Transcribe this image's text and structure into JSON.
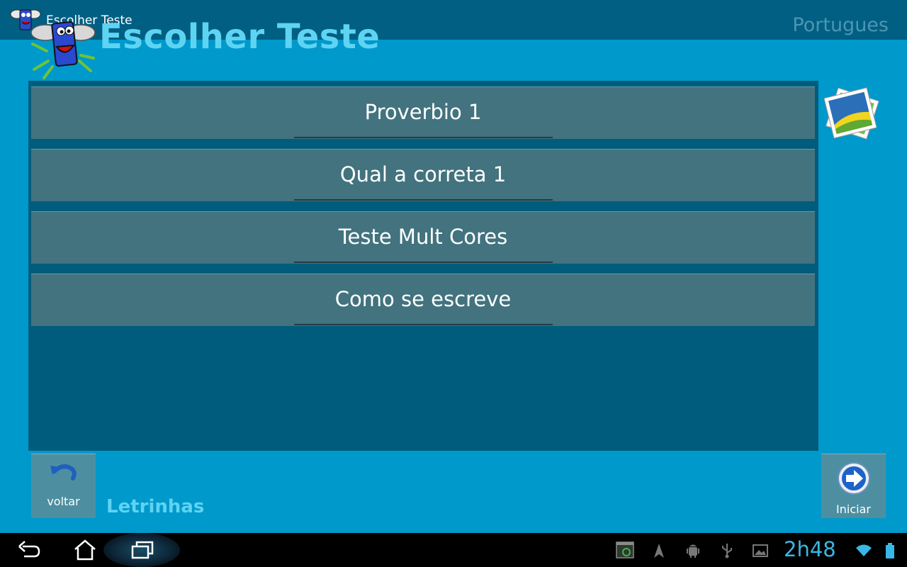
{
  "action_bar": {
    "title": "Escolher Teste",
    "language": "Portugues"
  },
  "header": {
    "title": "Escolher Teste"
  },
  "tests": [
    {
      "label": "Proverbio 1"
    },
    {
      "label": "Qual a correta 1"
    },
    {
      "label": "Teste Mult Cores"
    },
    {
      "label": "Como se escreve"
    }
  ],
  "buttons": {
    "back_label": "voltar",
    "start_label": "Iniciar"
  },
  "footer": {
    "app_name": "Letrinhas"
  },
  "system_bar": {
    "time": "2h48",
    "icons": [
      "back-icon",
      "home-icon",
      "recent-apps-icon",
      "screenshot-icon",
      "location-icon",
      "android-debug-icon",
      "usb-icon",
      "gallery-icon",
      "wifi-icon",
      "battery-icon"
    ]
  },
  "colors": {
    "background": "#0099cc",
    "action_bar": "#005f82",
    "list_panel": "#005c7c",
    "item": "#42737f",
    "accent_text": "#5ed4f2",
    "clock": "#39b7e6"
  }
}
